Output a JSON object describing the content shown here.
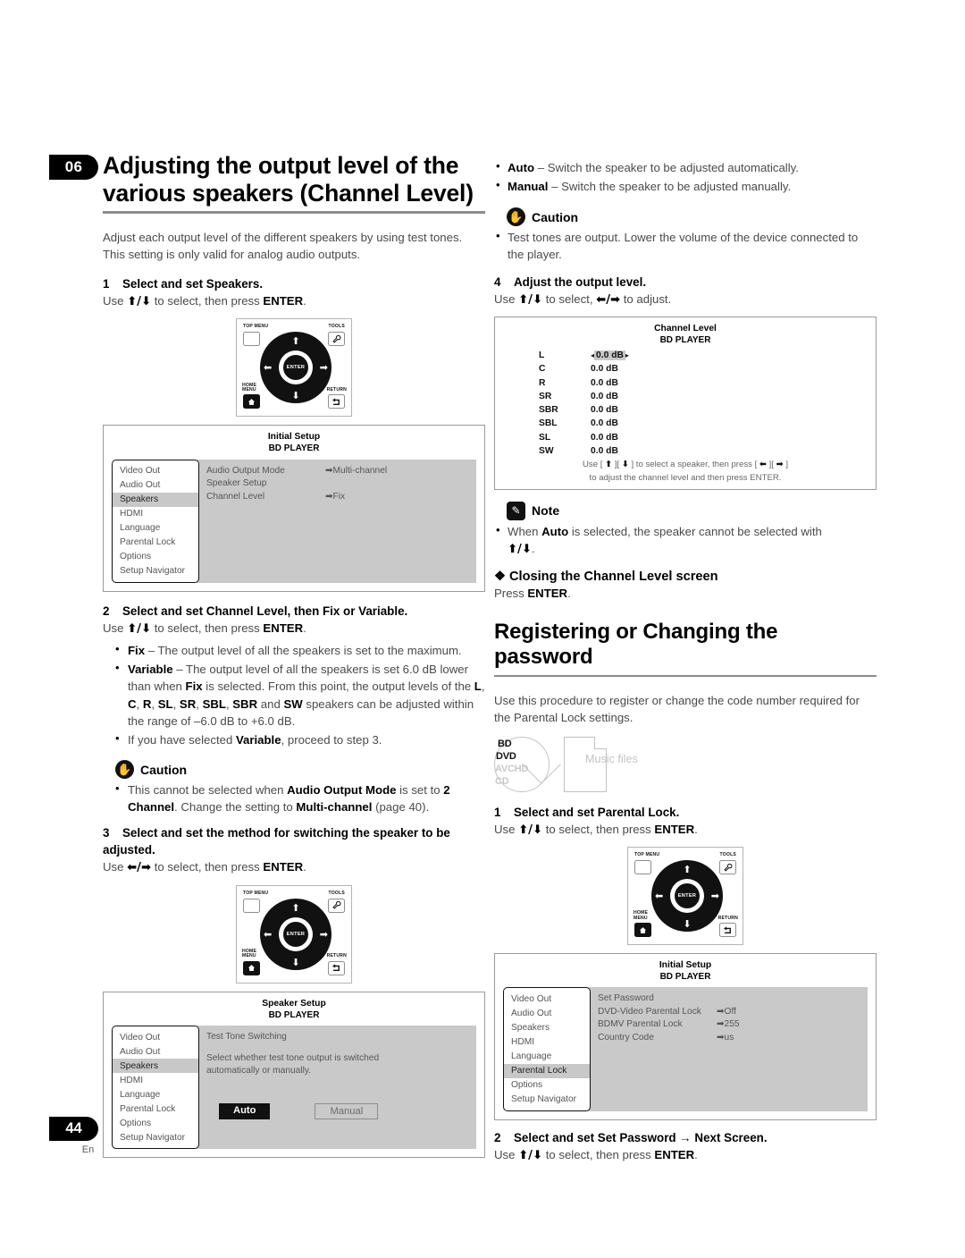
{
  "page": {
    "number": "44",
    "language": "En",
    "chapter": "06"
  },
  "left": {
    "chapter_title": "Adjusting the output level of the various speakers (Channel Level)",
    "intro": "Adjust each output level of the different speakers by using test tones. This setting is only valid for analog audio outputs.",
    "step1": {
      "num": "1",
      "title": "Select and set Speakers.",
      "instruction_pre": "Use ",
      "keys": "↑/↓",
      "instruction_mid": " to select, then press ",
      "key_enter": "ENTER",
      "instruction_post": "."
    },
    "remote1": {
      "top_menu": "TOP MENU",
      "tools": "TOOLS",
      "home_menu": "HOME\nMENU",
      "return": "RETURN",
      "enter": "ENTER",
      "up": "⬆",
      "down": "⬇",
      "left": "⬅",
      "right": "➡"
    },
    "osd_initial_setup": {
      "title": "Initial Setup",
      "subtitle": "BD PLAYER",
      "menu": [
        "Video Out",
        "Audio Out",
        "Speakers",
        "HDMI",
        "Language",
        "Parental Lock",
        "Options",
        "Setup Navigator"
      ],
      "selected": "Speakers",
      "rows": [
        {
          "name": "Audio Output Mode",
          "value": "Multi-channel",
          "has_arrow": true
        },
        {
          "name": "Speaker Setup",
          "value": "",
          "has_arrow": false
        },
        {
          "name": "Channel Level",
          "value": "Fix",
          "has_arrow": true
        }
      ]
    },
    "step2": {
      "num": "2",
      "title": "Select and set Channel Level, then Fix or Variable.",
      "instruction": "Use ↑/↓ to select, then press ENTER.",
      "bullets": [
        "Fix – The output level of all the speakers is set to the maximum.",
        "Variable – The output level of all the speakers is set 6.0 dB lower than when Fix is selected. From this point, the output levels of the L, C, R, SL, SR, SBL, SBR and SW speakers can be adjusted within the range of –6.0 dB to +6.0 dB.",
        "If you have selected Variable, proceed to step 3."
      ]
    },
    "caution": {
      "label": "Caution",
      "bullet": "This cannot be selected when Audio Output Mode is set to 2 Channel. Change the setting to Multi-channel (page 40)."
    },
    "step3": {
      "num": "3",
      "title": "Select and set the method for switching the speaker to be adjusted.",
      "instruction": "Use ⬅/➡ to select, then press ENTER."
    },
    "osd_speaker_setup": {
      "title": "Speaker Setup",
      "subtitle": "BD PLAYER",
      "menu": [
        "Video Out",
        "Audio Out",
        "Speakers",
        "HDMI",
        "Language",
        "Parental Lock",
        "Options",
        "Setup Navigator"
      ],
      "selected": "Speakers",
      "heading": "Test Tone Switching",
      "description": "Select whether test tone output is switched automatically or manually.",
      "button_on": "Auto",
      "button_off": "Manual"
    }
  },
  "right": {
    "bullets_top": [
      "Auto – Switch the speaker to be adjusted automatically.",
      "Manual – Switch the speaker to be adjusted manually."
    ],
    "caution": {
      "label": "Caution",
      "bullet": "Test tones are output. Lower the volume of the device connected to the player."
    },
    "step4": {
      "num": "4",
      "title": "Adjust the output level.",
      "instruction": "Use ↑/↓ to select, ⬅/➡ to adjust."
    },
    "osd_channel_level": {
      "title": "Channel Level",
      "subtitle": "BD PLAYER",
      "channels": [
        {
          "name": "L",
          "value": "0.0 dB",
          "selected": true
        },
        {
          "name": "C",
          "value": "0.0 dB",
          "selected": false
        },
        {
          "name": "R",
          "value": "0.0 dB",
          "selected": false
        },
        {
          "name": "SR",
          "value": "0.0 dB",
          "selected": false
        },
        {
          "name": "SBR",
          "value": "0.0 dB",
          "selected": false
        },
        {
          "name": "SBL",
          "value": "0.0 dB",
          "selected": false
        },
        {
          "name": "SL",
          "value": "0.0 dB",
          "selected": false
        },
        {
          "name": "SW",
          "value": "0.0 dB",
          "selected": false
        }
      ],
      "footer_line1": "Use [ ↑ ][ ↓ ] to select a speaker, then press [ ⬅ ][ ➡ ]",
      "footer_line2": "to adjust the channel level and then press ENTER."
    },
    "note": {
      "label": "Note",
      "bullet": "When Auto is selected, the speaker cannot be selected with ↑/↓."
    },
    "subheading": {
      "marker": "❖",
      "text": "Closing the Channel Level screen",
      "body": "Press ENTER."
    },
    "section_title": "Registering or Changing the password",
    "section_intro": "Use this procedure to register or change the code number required for the Parental Lock settings.",
    "media": {
      "disc_labels": [
        {
          "text": "BD",
          "active": true
        },
        {
          "text": "DVD",
          "active": true
        },
        {
          "text": "AVCHD",
          "active": false
        },
        {
          "text": "CD",
          "active": false
        }
      ],
      "file_label": "Music files"
    },
    "step1": {
      "num": "1",
      "title": "Select and set Parental Lock.",
      "instruction": "Use ↑/↓ to select, then press ENTER."
    },
    "remote2": {
      "top_menu": "TOP MENU",
      "tools": "TOOLS",
      "home_menu": "HOME\nMENU",
      "return": "RETURN",
      "enter": "ENTER"
    },
    "osd_initial_setup": {
      "title": "Initial Setup",
      "subtitle": "BD PLAYER",
      "menu": [
        "Video Out",
        "Audio Out",
        "Speakers",
        "HDMI",
        "Language",
        "Parental Lock",
        "Options",
        "Setup Navigator"
      ],
      "selected": "Parental Lock",
      "rows": [
        {
          "name": "Set Password",
          "value": "",
          "has_arrow": false
        },
        {
          "name": "DVD-Video Parental Lock",
          "value": "Off",
          "has_arrow": true
        },
        {
          "name": "BDMV Parental Lock",
          "value": "255",
          "has_arrow": true
        },
        {
          "name": "Country Code",
          "value": "us",
          "has_arrow": true
        }
      ]
    },
    "step2": {
      "num": "2",
      "title": "Select and set Set Password → Next Screen.",
      "instruction": "Use ↑/↓ to select, then press ENTER."
    }
  }
}
